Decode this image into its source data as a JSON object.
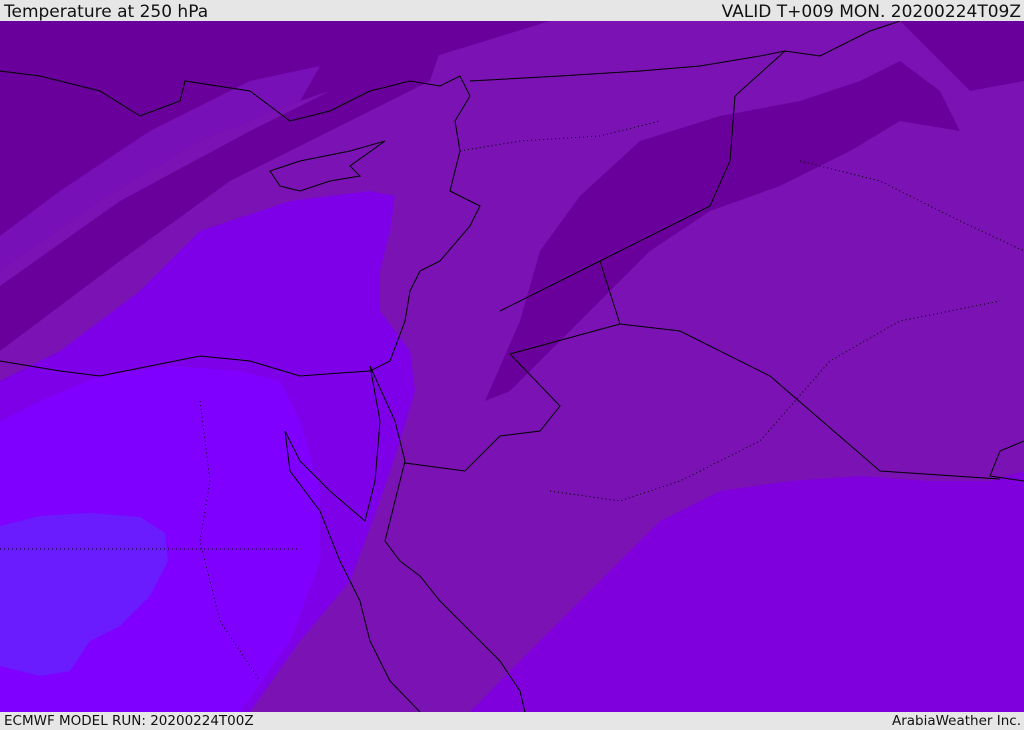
{
  "header": {
    "title": "Temperature at 250 hPa",
    "valid": "VALID T+009 MON. 20200224T09Z"
  },
  "footer": {
    "model_run": "ECMWF MODEL RUN: 20200224T00Z",
    "credit": "ArabiaWeather Inc."
  },
  "colors": {
    "base": "#7a12b4",
    "dark_band": "#6a009c",
    "mid_band": "#7810b8",
    "lower_right": "#7f00dc",
    "mediterranean": "#7e00e8",
    "bright": "#8000ff",
    "cold_blob": "#6a1cff",
    "borders": "#000000"
  }
}
